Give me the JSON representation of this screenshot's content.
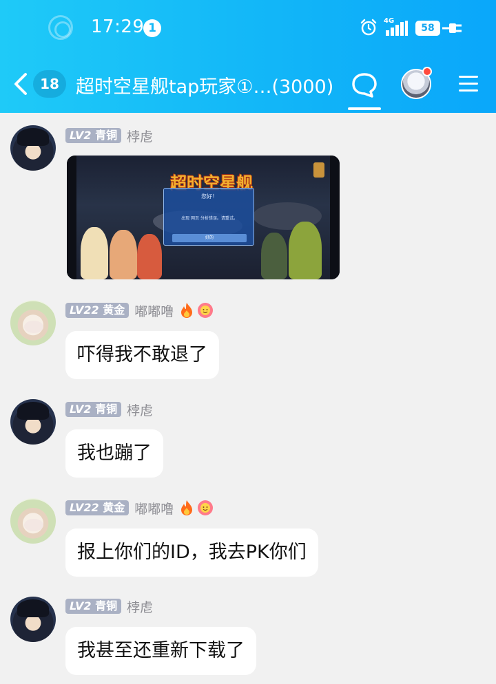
{
  "status_bar": {
    "time": "17:29",
    "notification_count": "1",
    "network": "4G",
    "battery": "58"
  },
  "nav": {
    "back_count": "18",
    "title": "超时空星舰tap玩家①…(3000)"
  },
  "messages": [
    {
      "level": "LV2",
      "rank": "青铜",
      "nickname": "桲䖈",
      "type": "image"
    },
    {
      "level": "LV22",
      "rank": "黄金",
      "nickname": "嘟嘟噜",
      "text": "吓得我不敢退了"
    },
    {
      "level": "LV2",
      "rank": "青铜",
      "nickname": "桲䖈",
      "text": "我也蹦了"
    },
    {
      "level": "LV22",
      "rank": "黄金",
      "nickname": "嘟嘟噜",
      "text": "报上你们的ID，我去PK你们"
    },
    {
      "level": "LV2",
      "rank": "青铜",
      "nickname": "桲䖈",
      "text": "我甚至还重新下载了"
    }
  ],
  "game_screenshot": {
    "logo": "超时空星舰",
    "dialog_title": "您好！",
    "dialog_body": "出现 网页 分析错误。请重试。",
    "dialog_button": "好的"
  },
  "colors": {
    "header_start": "#1fcaf8",
    "header_end": "#0aa7fa",
    "badge": "#aab1c4",
    "background": "#f1f1f1",
    "bubble": "#ffffff"
  }
}
